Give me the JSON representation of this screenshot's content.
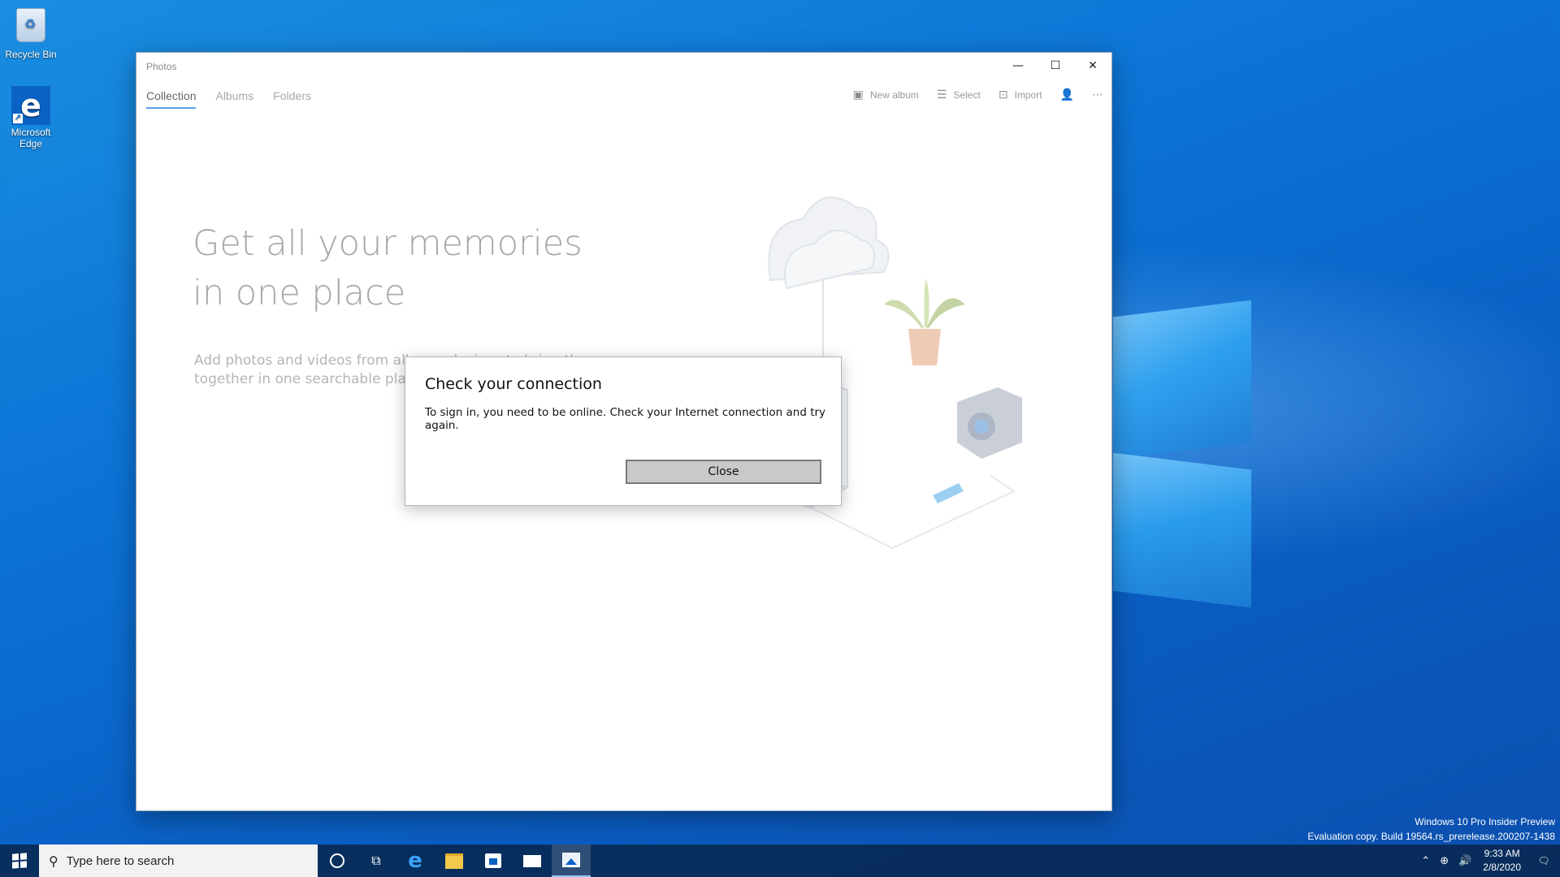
{
  "desktop": {
    "icons": [
      {
        "label": "Recycle Bin"
      },
      {
        "label": "Microsoft Edge"
      }
    ],
    "watermark": {
      "line1": "Windows 10 Pro Insider Preview",
      "line2": "Evaluation copy. Build 19564.rs_prerelease.200207-1438"
    }
  },
  "window": {
    "title": "Photos",
    "tabs": [
      {
        "label": "Collection",
        "active": true
      },
      {
        "label": "Albums",
        "active": false
      },
      {
        "label": "Folders",
        "active": false
      }
    ],
    "toolbar": {
      "new_album": "New album",
      "select": "Select",
      "import": "Import"
    },
    "hero": {
      "title": "Get all your memories in one place",
      "subtitle": "Add photos and videos from all your devices to bring them together in one searchable place."
    }
  },
  "dialog": {
    "title": "Check your connection",
    "message": "To sign in, you need to be online. Check your Internet connection and try again.",
    "button": "Close"
  },
  "taskbar": {
    "search_placeholder": "Type here to search",
    "time": "9:33 AM",
    "date": "2/8/2020"
  },
  "colors": {
    "accent": "#0b62c5",
    "desktop": "#0c74d6",
    "taskbar": "#082850"
  }
}
